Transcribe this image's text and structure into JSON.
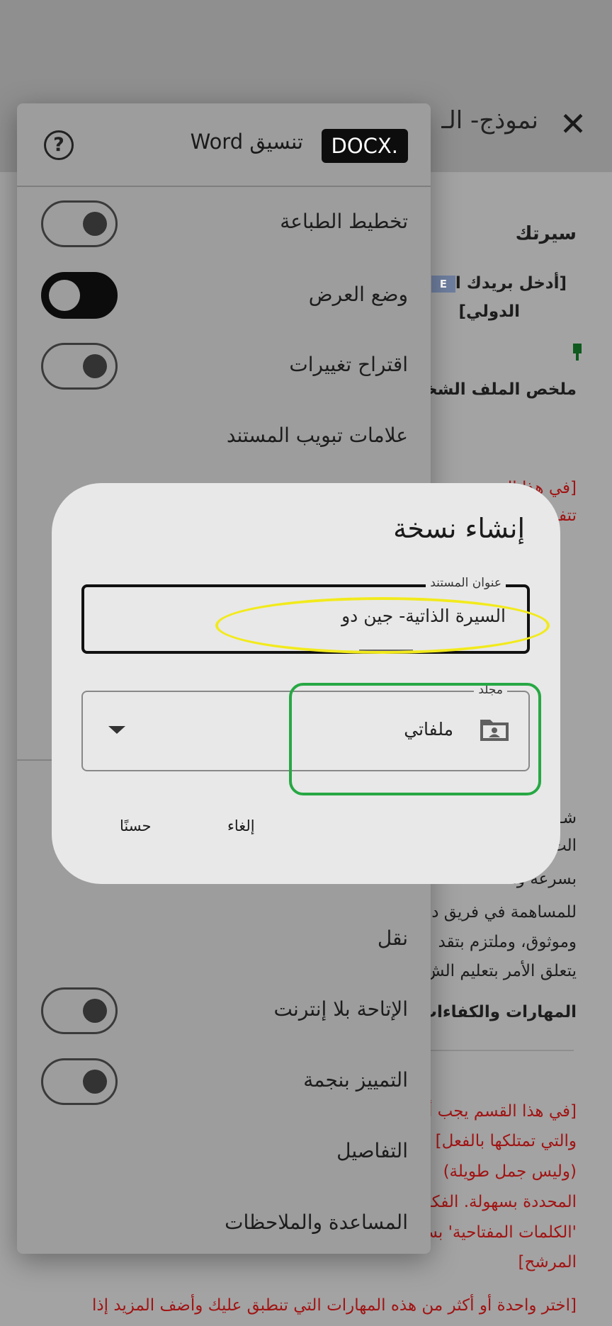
{
  "document": {
    "title": "نموذج- الـ",
    "close_icon": "close-icon",
    "lines": [
      {
        "text": "سيرتك",
        "style": "b"
      },
      {
        "text": "[أدخل بريدك ا",
        "style": "b"
      },
      {
        "text": "الدولي]",
        "style": "b"
      },
      {
        "text": "ملخص الملف الشخص",
        "style": "b"
      },
      {
        "text": "[في هذا القسم",
        "style": "red"
      },
      {
        "text": "تتفـ",
        "style": "red"
      },
      {
        "text": "شـ",
        "style": ""
      },
      {
        "text": "الت",
        "style": ""
      },
      {
        "text": "بسرعة وأ",
        "style": ""
      },
      {
        "text": "للمساهمة في فريق د",
        "style": ""
      },
      {
        "text": "وموثوق، وملتزم بتقد",
        "style": ""
      },
      {
        "text": "يتعلق الأمر بتعليم الش",
        "style": ""
      },
      {
        "text": "المهارات والكفاءات",
        "style": "b"
      },
      {
        "text": "[في هذا القسم يجب أ",
        "style": "red"
      },
      {
        "text": "والتي تمتلكها بالفعل]",
        "style": "red"
      },
      {
        "text": "(وليس جمل طويلة)",
        "style": "red"
      },
      {
        "text": "المحددة بسهولة. الفكر",
        "style": "red"
      },
      {
        "text": "'الكلمات المفتاحية' بس",
        "style": "red"
      },
      {
        "text": "المرشح]",
        "style": "red"
      },
      {
        "text": "[اختر واحدة أو أكثر من هذه المهارات التي تنطبق عليك وأضف المزيد إذا",
        "style": "red"
      }
    ]
  },
  "panel": {
    "format_badge": "DOCX.",
    "format_label": "تنسيق Word",
    "help_icon": "help-icon",
    "options": [
      {
        "label": "تخطيط الطباعة",
        "toggle": "off"
      },
      {
        "label": "وضع العرض",
        "toggle": "on"
      },
      {
        "label": "اقتراح تغييرات",
        "toggle": "off"
      },
      {
        "label": "علامات تبويب المستند",
        "toggle": "none"
      },
      {
        "label": "نقل",
        "toggle": "none"
      },
      {
        "label": "الإتاحة بلا إنترنت",
        "toggle": "off"
      },
      {
        "label": "التمييز بنجمة",
        "toggle": "off"
      },
      {
        "label": "التفاصيل",
        "toggle": "none"
      },
      {
        "label": "المساعدة والملاحظات",
        "toggle": "none"
      }
    ]
  },
  "dialog": {
    "title": "إنشاء نسخة",
    "doc_title_label": "عنوان المستند",
    "doc_title_value": "السيرة الذاتية- جين دو",
    "folder_label": "مجلد",
    "folder_value": "ملفاتي",
    "folder_icon": "folder-shared-icon",
    "cancel_label": "إلغاء",
    "ok_label": "حسنًا"
  },
  "colors": {
    "highlight_yellow": "#f2ea1c",
    "highlight_green": "#27a844",
    "doc_red_text": "#a11414"
  }
}
